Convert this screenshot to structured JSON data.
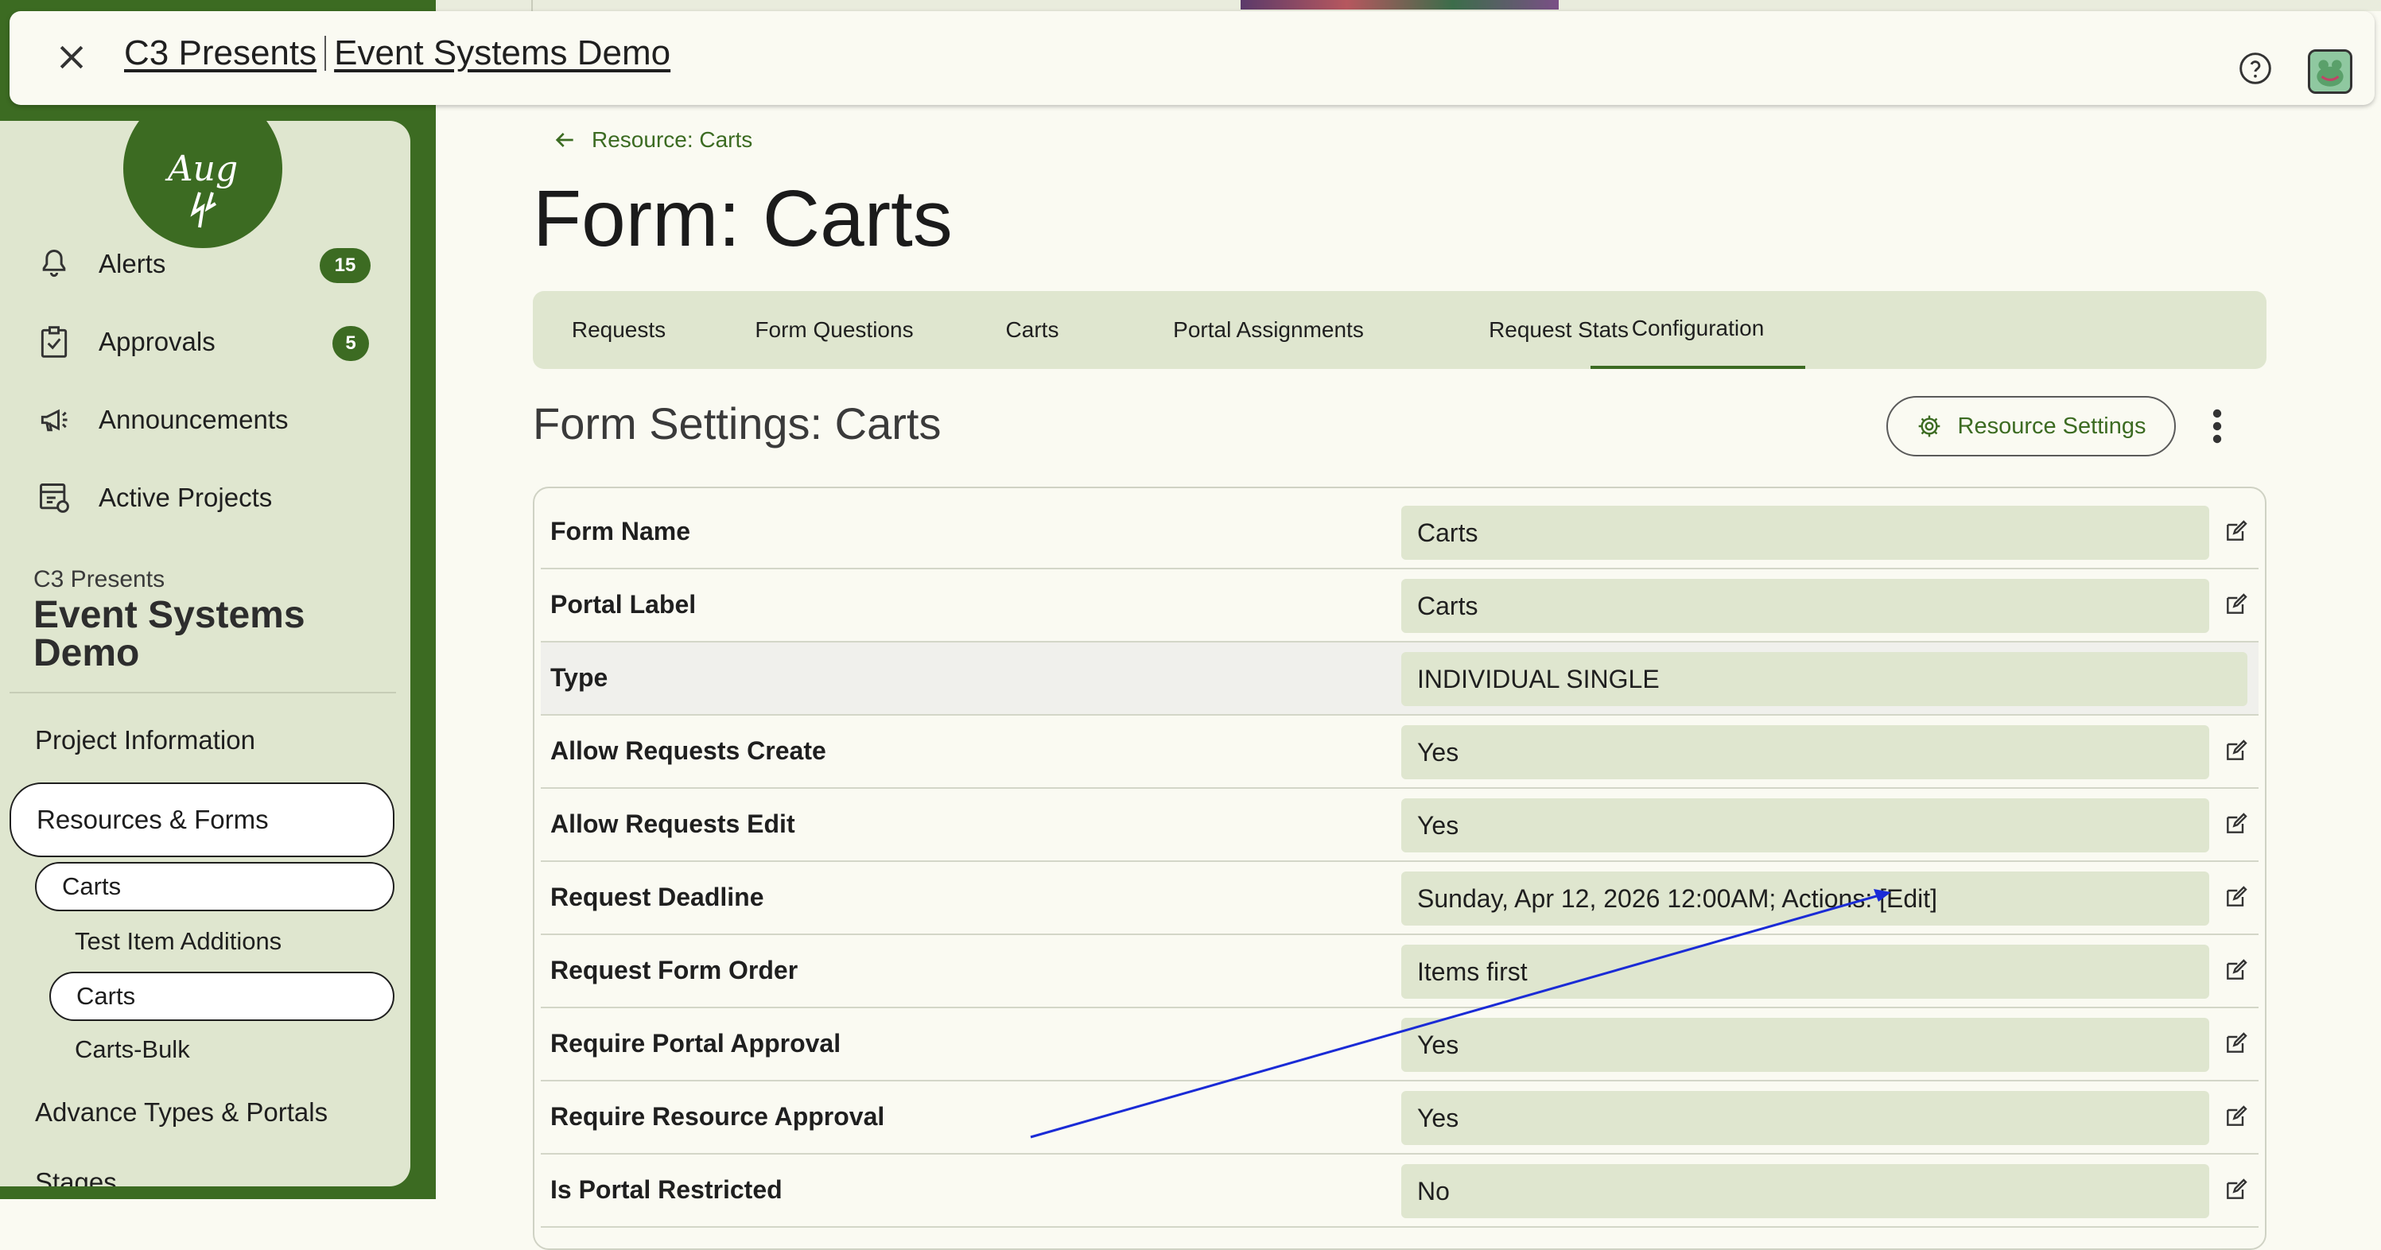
{
  "topbar": {
    "org": "C3 Presents",
    "project": "Event Systems Demo"
  },
  "sidebar": {
    "nav": [
      {
        "label": "Alerts",
        "badge": "15",
        "icon": "bell-icon"
      },
      {
        "label": "Approvals",
        "badge": "5",
        "icon": "clipboard-check-icon"
      },
      {
        "label": "Announcements",
        "icon": "megaphone-icon"
      },
      {
        "label": "Active Projects",
        "icon": "projects-icon"
      }
    ],
    "org_label": "C3 Presents",
    "project_title": "Event Systems Demo",
    "links": {
      "project_info": "Project Information",
      "resources_forms": "Resources & Forms",
      "carts_group": "Carts",
      "test_item": "Test Item Additions",
      "carts_form": "Carts",
      "carts_bulk": "Carts-Bulk",
      "advance_types": "Advance Types & Portals",
      "stages": "Stages"
    }
  },
  "main": {
    "back_label": "Resource: Carts",
    "title": "Form: Carts",
    "tabs": [
      "Requests",
      "Form Questions",
      "Carts",
      "Portal Assignments",
      "Request Stats",
      "Configuration"
    ],
    "active_tab": "Configuration",
    "section_title": "Form Settings: Carts",
    "resource_settings_label": "Resource Settings",
    "rows": [
      {
        "label": "Form Name",
        "value": "Carts",
        "editable": true
      },
      {
        "label": "Portal Label",
        "value": "Carts",
        "editable": true
      },
      {
        "label": "Type",
        "value": "INDIVIDUAL SINGLE",
        "editable": false
      },
      {
        "label": "Allow Requests Create",
        "value": "Yes",
        "editable": true
      },
      {
        "label": "Allow Requests Edit",
        "value": "Yes",
        "editable": true
      },
      {
        "label": "Request Deadline",
        "value": "Sunday, Apr 12, 2026 12:00AM; Actions: [Edit]",
        "editable": true
      },
      {
        "label": "Request Form Order",
        "value": "Items first",
        "editable": true
      },
      {
        "label": "Require Portal Approval",
        "value": "Yes",
        "editable": true
      },
      {
        "label": "Require Resource Approval",
        "value": "Yes",
        "editable": true
      },
      {
        "label": "Is Portal Restricted",
        "value": "No",
        "editable": true
      }
    ]
  },
  "colors": {
    "brand_green": "#3c6b22",
    "panel_green": "#dfe6cf",
    "page_bg": "#fafaf2",
    "annotation_arrow": "#1a2bd6"
  }
}
